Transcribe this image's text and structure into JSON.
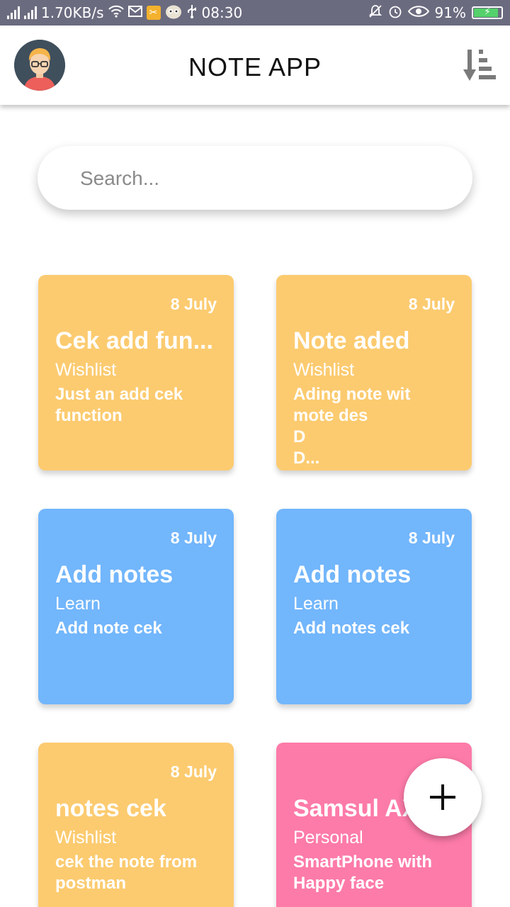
{
  "status_bar": {
    "network_speed": "1.70KB/s",
    "time": "08:30",
    "battery": "91%",
    "battery_level": 0.91,
    "icons": [
      "signal-icon",
      "signal-icon",
      "wifi-icon",
      "mail-icon",
      "app-badge-icon",
      "owl-icon",
      "usb-icon",
      "mute-icon",
      "alarm-icon",
      "eye-icon",
      "battery-icon"
    ]
  },
  "app_bar": {
    "title": "NOTE APP",
    "avatar_icon": "user-avatar",
    "sort_icon": "sort-descending-icon"
  },
  "search": {
    "placeholder": "Search...",
    "value": ""
  },
  "colors": {
    "wishlist": "#fccb70",
    "learn": "#72b6fc",
    "personal": "#fd7ba8"
  },
  "notes": [
    {
      "date": "8 July",
      "title": "Cek add fun...",
      "category": "Wishlist",
      "description": "Just an add cek function",
      "color": "#fccb70"
    },
    {
      "date": "8 July",
      "title": "Note aded",
      "category": "Wishlist",
      "description": "Ading note wit\nmote des\nD\nD...",
      "color": "#fccb70"
    },
    {
      "date": "8 July",
      "title": "Add notes",
      "category": "Learn",
      "description": "Add note cek",
      "color": "#72b6fc"
    },
    {
      "date": "8 July",
      "title": "Add notes",
      "category": "Learn",
      "description": "Add notes cek",
      "color": "#72b6fc"
    },
    {
      "date": "8 July",
      "title": "notes cek",
      "category": "Wishlist",
      "description": "cek the note from postman",
      "color": "#fccb70"
    },
    {
      "date": "8",
      "title": "Samsul AX",
      "category": "Personal",
      "description": "SmartPhone with Happy face",
      "color": "#fd7ba8"
    }
  ],
  "fab": {
    "icon": "plus-icon"
  }
}
